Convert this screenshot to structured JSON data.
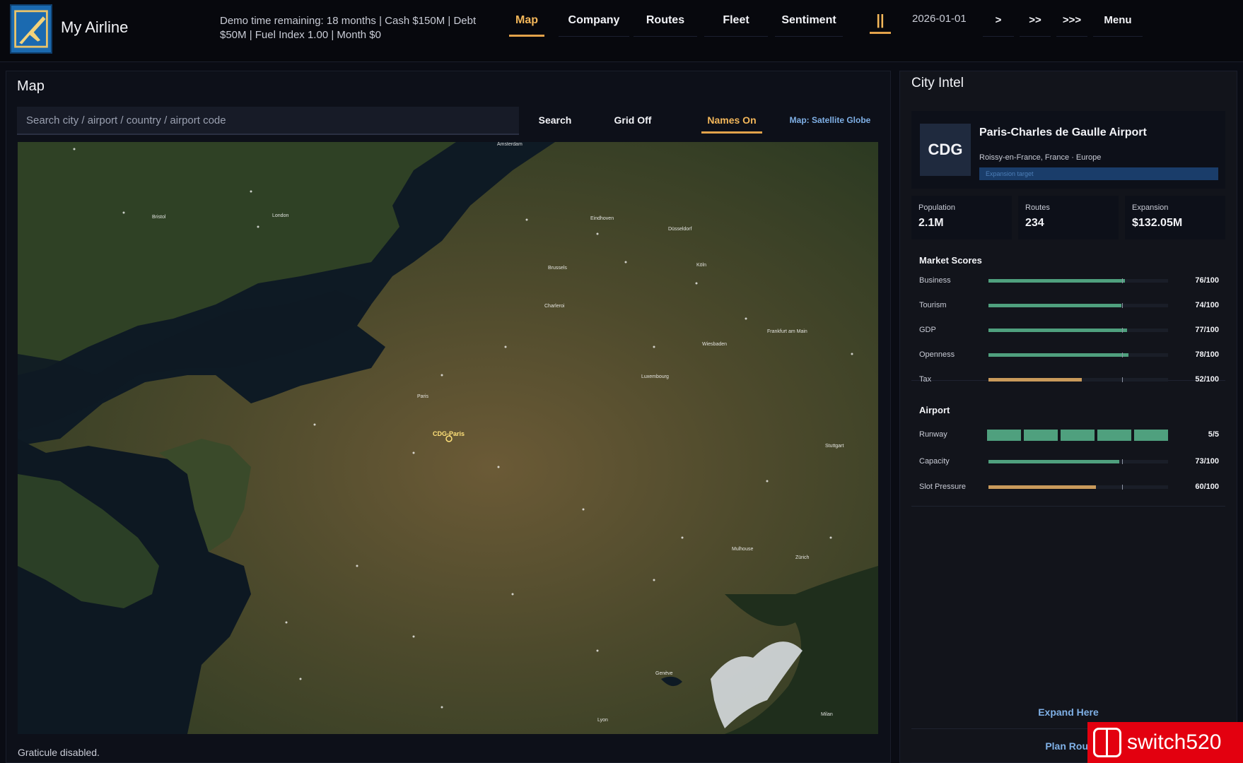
{
  "header": {
    "brand": "My Airline",
    "status_line1": "Demo time remaining: 18 months  |  Cash $150M  |  Debt",
    "status_line2": "$50M  |  Fuel Index 1.00  |  Month $0",
    "nav": [
      "Map",
      "Company",
      "Routes",
      "Fleet",
      "Sentiment"
    ],
    "pause_label": "||",
    "date": "2026-01-01",
    "speeds": [
      ">",
      ">>",
      ">>>"
    ],
    "menu_label": "Menu"
  },
  "map_panel": {
    "title": "Map",
    "search_placeholder": "Search city / airport / country / airport code",
    "search_label": "Search",
    "grid_label": "Grid Off",
    "names_label": "Names On",
    "mapmode_label": "Map: Satellite Globe",
    "footnote": "Graticule disabled.",
    "places": [
      "Amsterdam",
      "Bristol",
      "London",
      "Eindhoven",
      "Düsseldorf",
      "Brussels",
      "Köln",
      "Charleroi",
      "Frankfurt am Main",
      "Wiesbaden",
      "Luxembourg",
      "Paris",
      "CDG-Paris",
      "Stuttgart",
      "Mulhouse",
      "Zürich",
      "Genève",
      "Lyon",
      "Milan"
    ]
  },
  "intel": {
    "title": "City Intel",
    "code": "CDG",
    "airport_name": "Paris-Charles de Gaulle Airport",
    "location": "Roissy-en-France, France · Europe",
    "badge": "Expansion target",
    "stats": [
      {
        "label": "Population",
        "value": "2.1M"
      },
      {
        "label": "Routes",
        "value": "234"
      },
      {
        "label": "Expansion",
        "value": "$132.05M"
      }
    ],
    "market_title": "Market Scores",
    "market": [
      {
        "label": "Business",
        "value": "76/100",
        "score": 76
      },
      {
        "label": "Tourism",
        "value": "74/100",
        "score": 74
      },
      {
        "label": "GDP",
        "value": "77/100",
        "score": 77
      },
      {
        "label": "Openness",
        "value": "78/100",
        "score": 78
      },
      {
        "label": "Tax",
        "value": "52/100",
        "score": 52
      }
    ],
    "airport_title": "Airport",
    "runway": {
      "label": "Runway",
      "value": "5/5",
      "filled": 5,
      "total": 5
    },
    "airport_rows": [
      {
        "label": "Capacity",
        "value": "73/100",
        "score": 73
      },
      {
        "label": "Slot Pressure",
        "value": "60/100",
        "score": 60
      }
    ],
    "actions": [
      "Expand Here",
      "Plan Rout"
    ]
  },
  "colors": {
    "accent": "#e2a24a",
    "good": "#4fa07e",
    "warn": "#c99a5b",
    "link": "#7fb0e6"
  },
  "watermark": "switch520"
}
